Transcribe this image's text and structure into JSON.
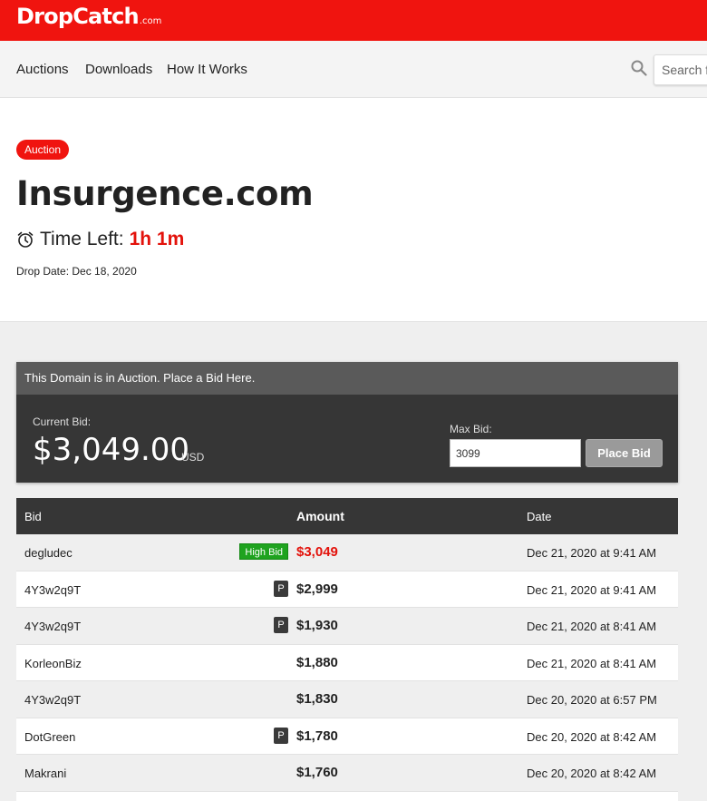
{
  "header": {
    "logo_main": "DropCatch",
    "logo_tld": ".com"
  },
  "nav": {
    "links": [
      "Auctions",
      "Downloads",
      "How It Works"
    ],
    "search_placeholder": "Search for domains"
  },
  "listing": {
    "badge": "Auction",
    "domain": "Insurgence.com",
    "time_left_label": "Time Left:",
    "time_left_value": "1h 1m",
    "drop_date": "Drop Date: Dec 18, 2020"
  },
  "bid_panel": {
    "heading": "This Domain is in Auction. Place a Bid Here.",
    "current_bid_label": "Current Bid:",
    "current_bid_value": "$3,049.00",
    "currency": "USD",
    "max_bid_label": "Max Bid:",
    "max_bid_value": "3099",
    "place_bid_label": "Place Bid"
  },
  "bid_table": {
    "columns": {
      "bid": "Bid",
      "amount": "Amount",
      "date": "Date"
    },
    "rows": [
      {
        "bidder": "degludec",
        "tag": "High Bid",
        "amount": "$3,049",
        "date": "Dec 21, 2020 at 9:41 AM"
      },
      {
        "bidder": "4Y3w2q9T",
        "tag": "P",
        "amount": "$2,999",
        "date": "Dec 21, 2020 at 9:41 AM"
      },
      {
        "bidder": "4Y3w2q9T",
        "tag": "P",
        "amount": "$1,930",
        "date": "Dec 21, 2020 at 8:41 AM"
      },
      {
        "bidder": "KorleonBiz",
        "tag": "",
        "amount": "$1,880",
        "date": "Dec 21, 2020 at 8:41 AM"
      },
      {
        "bidder": "4Y3w2q9T",
        "tag": "",
        "amount": "$1,830",
        "date": "Dec 20, 2020 at 6:57 PM"
      },
      {
        "bidder": "DotGreen",
        "tag": "P",
        "amount": "$1,780",
        "date": "Dec 20, 2020 at 8:42 AM"
      },
      {
        "bidder": "Makrani",
        "tag": "",
        "amount": "$1,760",
        "date": "Dec 20, 2020 at 8:42 AM"
      }
    ]
  },
  "colors": {
    "brand": "#f0140f",
    "high_bid": "#1fa31f",
    "panel": "#363636"
  }
}
